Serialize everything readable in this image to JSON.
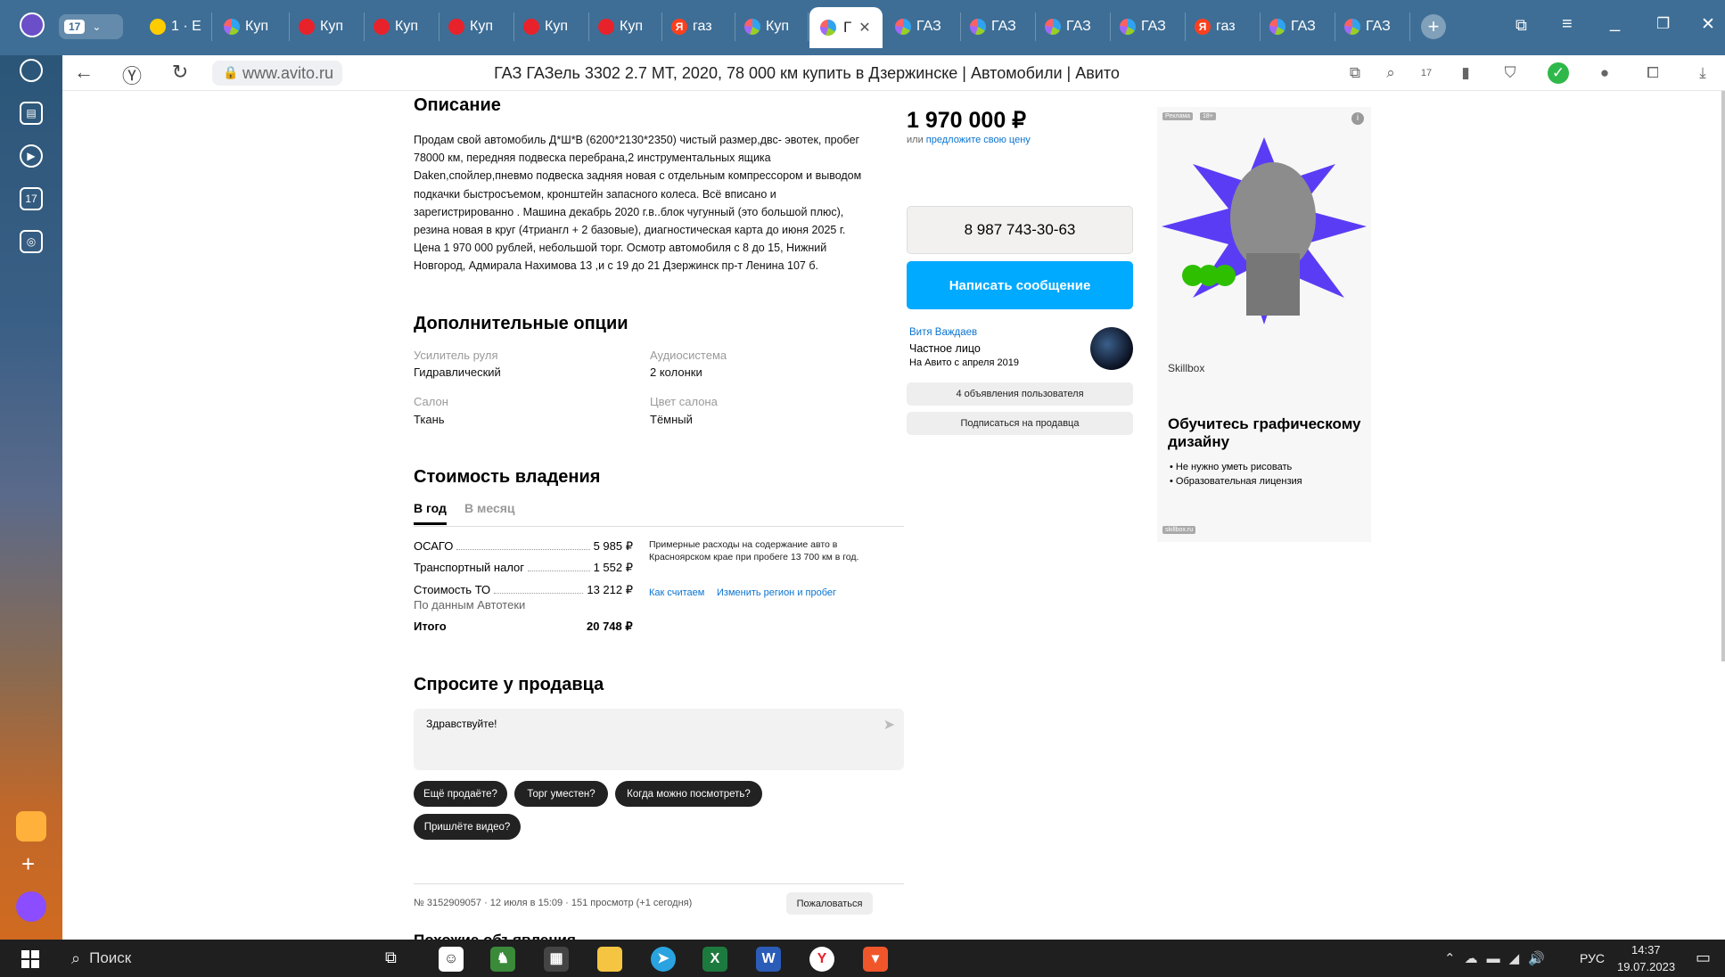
{
  "browser": {
    "tab_count_badge": "17",
    "tabs": [
      {
        "label": "1 · E",
        "icon": "mail-icon"
      },
      {
        "label": "Куп",
        "icon": "avito-icon"
      },
      {
        "label": "Куп",
        "icon": "red-icon"
      },
      {
        "label": "Куп",
        "icon": "red-icon"
      },
      {
        "label": "Куп",
        "icon": "red-icon"
      },
      {
        "label": "Куп",
        "icon": "red-icon"
      },
      {
        "label": "Куп",
        "icon": "red-icon"
      },
      {
        "label": "газ",
        "icon": "yandex-icon"
      },
      {
        "label": "Куп",
        "icon": "avito-icon"
      },
      {
        "label": "ГАЗ",
        "icon": "avito-icon"
      },
      {
        "label": "ГАЗ",
        "icon": "avito-icon"
      },
      {
        "label": "ГАЗ",
        "icon": "avito-icon"
      },
      {
        "label": "ГАЗ",
        "icon": "avito-icon"
      },
      {
        "label": "газ",
        "icon": "yandex-icon"
      },
      {
        "label": "ГАЗ",
        "icon": "avito-icon"
      },
      {
        "label": "ГАЗ",
        "icon": "avito-icon"
      }
    ],
    "active_tab_label": "Г",
    "url": "www.avito.ru",
    "page_title": "ГАЗ ГАЗель 3302 2.7 MT, 2020, 78 000 км купить в Дзержинске | Автомобили | Авито",
    "downloads_badge": "17",
    "sidebar_badge": "17"
  },
  "listing": {
    "description_title": "Описание",
    "description_text": "Продам свой автомобиль Д*Ш*В (6200*2130*2350) чистый размер,двс- эвотек, пробег 78000 км, передняя подвеска перебрана,2 инструментальных ящика Daken,спойлер,пневмо подвеска задняя новая с отдельным компрессором и выводом подкачки быстросъемом, кронштейн запасного колеса. Всё вписано и зарегистрированно . Машина декабрь 2020 г.в..блок чугунный (это большой плюс), резина новая в круг (4триангл + 2 базовые), диагностическая карта до июня 2025 г. Цена 1 970 000 рублей, небольшой торг. Осмотр автомобиля с 8 до 15, Нижний Новгород, Адмирала Нахимова 13 ,и с 19 до 21 Дзержинск пр-т Ленина 107 б.",
    "options_title": "Дополнительные опции",
    "options": [
      {
        "label": "Усилитель руля",
        "value": "Гидравлический"
      },
      {
        "label": "Аудиосистема",
        "value": "2 колонки"
      },
      {
        "label": "Салон",
        "value": "Ткань"
      },
      {
        "label": "Цвет салона",
        "value": "Тёмный"
      }
    ],
    "ownership_title": "Стоимость владения",
    "ownership_tabs": [
      "В год",
      "В месяц"
    ],
    "costs": [
      {
        "label": "ОСАГО",
        "value": "5 985 ₽"
      },
      {
        "label": "Транспортный налог",
        "value": "1 552 ₽"
      },
      {
        "label": "Стоимость ТО",
        "value": "13 212 ₽"
      }
    ],
    "costs_source": "По данным Автотеки",
    "total_label": "Итого",
    "total_value": "20 748 ₽",
    "costs_note": "Примерные расходы на содержание авто в Красноярском крае при пробеге 13 700 км в год.",
    "link_how": "Как считаем",
    "link_change": "Изменить регион и пробег",
    "ask_title": "Спросите у продавца",
    "ask_placeholder": "Здравствуйте!",
    "quick_questions": [
      "Ещё продаёте?",
      "Торг уместен?",
      "Когда можно посмотреть?",
      "Пришлёте видео?"
    ],
    "meta": "№ 3152909057 · 12 июля в 15:09 · 151 просмотр (+1 сегодня)",
    "complain": "Пожаловаться",
    "similar_title": "Похожие объявления"
  },
  "seller": {
    "price": "1 970 000 ₽",
    "offer_prefix": "или",
    "offer_link": "предложите свою цену",
    "phone": "8 987 743-30-63",
    "message_btn": "Написать сообщение",
    "name": "Витя Важдаев",
    "type": "Частное лицо",
    "since": "На Авито с апреля 2019",
    "ads_btn": "4 объявления пользователя",
    "subscribe_btn": "Подписаться на продавца"
  },
  "ad": {
    "tag": "Реклама",
    "age": "18+",
    "brand": "Skillbox",
    "headline": "Обучитесь графическому дизайну",
    "bullets": [
      "Не нужно уметь рисовать",
      "Образовательная лицензия"
    ],
    "domain": "skillbox.ru"
  },
  "taskbar": {
    "search": "Поиск",
    "lang": "РУС",
    "time": "14:37",
    "date": "19.07.2023"
  },
  "colors": {
    "accent_blue": "#00aaff",
    "link_blue": "#0a74d1",
    "tabbar": "#3e6e96"
  }
}
